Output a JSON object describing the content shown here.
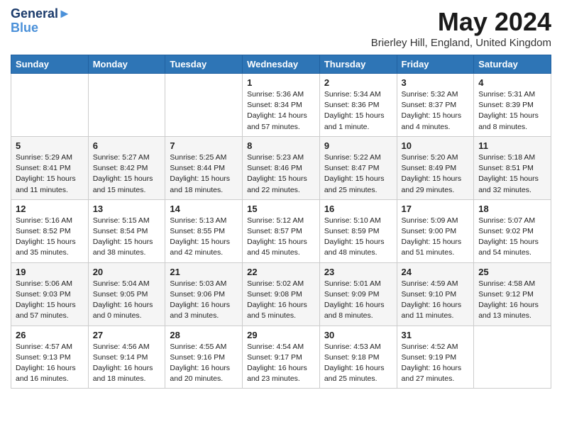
{
  "logo": {
    "text1": "General",
    "text2": "Blue"
  },
  "title": "May 2024",
  "location": "Brierley Hill, England, United Kingdom",
  "headers": [
    "Sunday",
    "Monday",
    "Tuesday",
    "Wednesday",
    "Thursday",
    "Friday",
    "Saturday"
  ],
  "weeks": [
    [
      {
        "num": "",
        "info": ""
      },
      {
        "num": "",
        "info": ""
      },
      {
        "num": "",
        "info": ""
      },
      {
        "num": "1",
        "info": "Sunrise: 5:36 AM\nSunset: 8:34 PM\nDaylight: 14 hours\nand 57 minutes."
      },
      {
        "num": "2",
        "info": "Sunrise: 5:34 AM\nSunset: 8:36 PM\nDaylight: 15 hours\nand 1 minute."
      },
      {
        "num": "3",
        "info": "Sunrise: 5:32 AM\nSunset: 8:37 PM\nDaylight: 15 hours\nand 4 minutes."
      },
      {
        "num": "4",
        "info": "Sunrise: 5:31 AM\nSunset: 8:39 PM\nDaylight: 15 hours\nand 8 minutes."
      }
    ],
    [
      {
        "num": "5",
        "info": "Sunrise: 5:29 AM\nSunset: 8:41 PM\nDaylight: 15 hours\nand 11 minutes."
      },
      {
        "num": "6",
        "info": "Sunrise: 5:27 AM\nSunset: 8:42 PM\nDaylight: 15 hours\nand 15 minutes."
      },
      {
        "num": "7",
        "info": "Sunrise: 5:25 AM\nSunset: 8:44 PM\nDaylight: 15 hours\nand 18 minutes."
      },
      {
        "num": "8",
        "info": "Sunrise: 5:23 AM\nSunset: 8:46 PM\nDaylight: 15 hours\nand 22 minutes."
      },
      {
        "num": "9",
        "info": "Sunrise: 5:22 AM\nSunset: 8:47 PM\nDaylight: 15 hours\nand 25 minutes."
      },
      {
        "num": "10",
        "info": "Sunrise: 5:20 AM\nSunset: 8:49 PM\nDaylight: 15 hours\nand 29 minutes."
      },
      {
        "num": "11",
        "info": "Sunrise: 5:18 AM\nSunset: 8:51 PM\nDaylight: 15 hours\nand 32 minutes."
      }
    ],
    [
      {
        "num": "12",
        "info": "Sunrise: 5:16 AM\nSunset: 8:52 PM\nDaylight: 15 hours\nand 35 minutes."
      },
      {
        "num": "13",
        "info": "Sunrise: 5:15 AM\nSunset: 8:54 PM\nDaylight: 15 hours\nand 38 minutes."
      },
      {
        "num": "14",
        "info": "Sunrise: 5:13 AM\nSunset: 8:55 PM\nDaylight: 15 hours\nand 42 minutes."
      },
      {
        "num": "15",
        "info": "Sunrise: 5:12 AM\nSunset: 8:57 PM\nDaylight: 15 hours\nand 45 minutes."
      },
      {
        "num": "16",
        "info": "Sunrise: 5:10 AM\nSunset: 8:59 PM\nDaylight: 15 hours\nand 48 minutes."
      },
      {
        "num": "17",
        "info": "Sunrise: 5:09 AM\nSunset: 9:00 PM\nDaylight: 15 hours\nand 51 minutes."
      },
      {
        "num": "18",
        "info": "Sunrise: 5:07 AM\nSunset: 9:02 PM\nDaylight: 15 hours\nand 54 minutes."
      }
    ],
    [
      {
        "num": "19",
        "info": "Sunrise: 5:06 AM\nSunset: 9:03 PM\nDaylight: 15 hours\nand 57 minutes."
      },
      {
        "num": "20",
        "info": "Sunrise: 5:04 AM\nSunset: 9:05 PM\nDaylight: 16 hours\nand 0 minutes."
      },
      {
        "num": "21",
        "info": "Sunrise: 5:03 AM\nSunset: 9:06 PM\nDaylight: 16 hours\nand 3 minutes."
      },
      {
        "num": "22",
        "info": "Sunrise: 5:02 AM\nSunset: 9:08 PM\nDaylight: 16 hours\nand 5 minutes."
      },
      {
        "num": "23",
        "info": "Sunrise: 5:01 AM\nSunset: 9:09 PM\nDaylight: 16 hours\nand 8 minutes."
      },
      {
        "num": "24",
        "info": "Sunrise: 4:59 AM\nSunset: 9:10 PM\nDaylight: 16 hours\nand 11 minutes."
      },
      {
        "num": "25",
        "info": "Sunrise: 4:58 AM\nSunset: 9:12 PM\nDaylight: 16 hours\nand 13 minutes."
      }
    ],
    [
      {
        "num": "26",
        "info": "Sunrise: 4:57 AM\nSunset: 9:13 PM\nDaylight: 16 hours\nand 16 minutes."
      },
      {
        "num": "27",
        "info": "Sunrise: 4:56 AM\nSunset: 9:14 PM\nDaylight: 16 hours\nand 18 minutes."
      },
      {
        "num": "28",
        "info": "Sunrise: 4:55 AM\nSunset: 9:16 PM\nDaylight: 16 hours\nand 20 minutes."
      },
      {
        "num": "29",
        "info": "Sunrise: 4:54 AM\nSunset: 9:17 PM\nDaylight: 16 hours\nand 23 minutes."
      },
      {
        "num": "30",
        "info": "Sunrise: 4:53 AM\nSunset: 9:18 PM\nDaylight: 16 hours\nand 25 minutes."
      },
      {
        "num": "31",
        "info": "Sunrise: 4:52 AM\nSunset: 9:19 PM\nDaylight: 16 hours\nand 27 minutes."
      },
      {
        "num": "",
        "info": ""
      }
    ]
  ]
}
